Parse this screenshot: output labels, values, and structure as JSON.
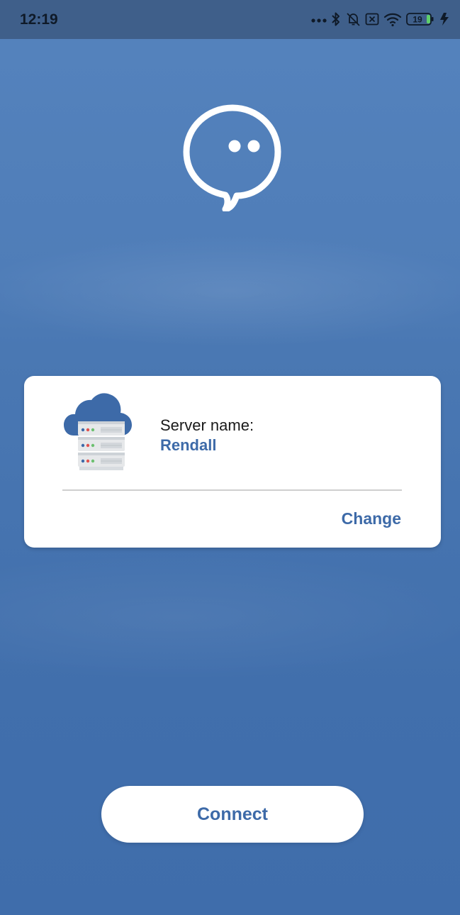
{
  "status_bar": {
    "time": "12:19",
    "battery_level": "19",
    "icons": [
      "more-dots-icon",
      "bluetooth-icon",
      "alarm-off-icon",
      "sim-off-icon",
      "wifi-icon",
      "battery-icon",
      "charging-icon"
    ]
  },
  "logo": {
    "icon": "chat-bubble-logo-icon"
  },
  "server_card": {
    "icon": "cloud-server-icon",
    "label": "Server name:",
    "value": "Rendall",
    "change_label": "Change"
  },
  "connect_button": {
    "label": "Connect"
  },
  "colors": {
    "background": "#4a78b3",
    "accent": "#3d6aa8",
    "card": "#ffffff",
    "status_bar": "#3f5f8a"
  }
}
